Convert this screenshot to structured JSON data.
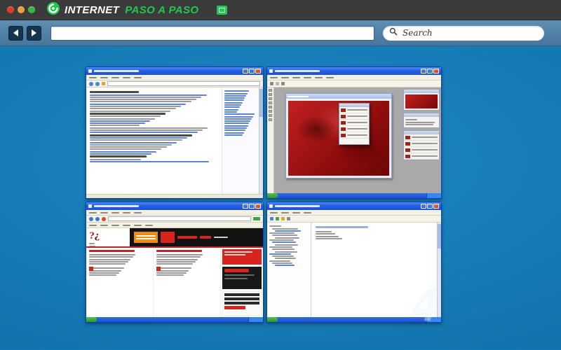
{
  "header": {
    "brand_white": "INTERNET",
    "brand_green": "PASO A PASO"
  },
  "toolbar": {
    "address_value": "",
    "search_placeholder": "Search"
  },
  "main": {
    "watermark": "4"
  },
  "icons": {
    "question_mark_primary": "?",
    "question_mark_secondary": "¿"
  },
  "colors": {
    "brand_green": "#1fc84f",
    "header_dark": "#3b3b3b",
    "toolbar_blue": "#52809f",
    "desktop_blue": "#1478b2",
    "xp_title_blue": "#2a63e4",
    "site_red": "#d8251c",
    "site_orange": "#ef8c12",
    "photoshop_canvas_red": "#a01212"
  }
}
